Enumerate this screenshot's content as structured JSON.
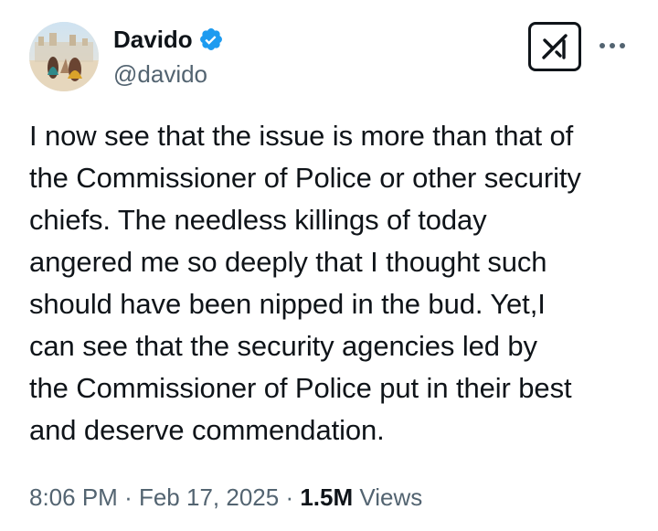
{
  "tweet": {
    "author": {
      "display_name": "Davido",
      "handle": "@davido",
      "verified": true,
      "verified_color": "#1d9bf0",
      "avatar_icon": "profile-photo"
    },
    "header_actions": {
      "grok_icon": "grok-icon",
      "more_icon": "more-horizontal-icon"
    },
    "text": "I now see that the issue is more than that of\nthe Commissioner of Police or other security\nchiefs. The needless killings of today\nangered me so deeply that I thought such\nshould have been nipped in the bud. Yet,I\ncan see that  the security agencies led by\nthe Commissioner of Police put in their best\nand deserve commendation.",
    "meta": {
      "time": "8:06 PM",
      "separator": "·",
      "date": "Feb 17, 2025",
      "views_count": "1.5M",
      "views_label": "Views"
    }
  },
  "colors": {
    "text_primary": "#0f1419",
    "text_secondary": "#536471",
    "background": "#ffffff"
  }
}
